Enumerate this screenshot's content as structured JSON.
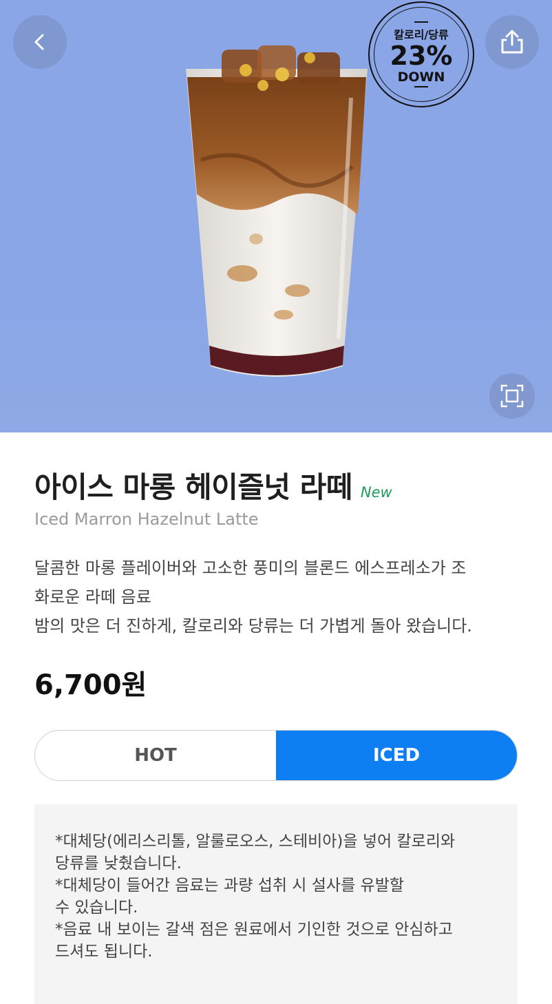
{
  "hero": {
    "badge": {
      "top": "칼로리/당류",
      "percent": "23%",
      "bottom": "DOWN"
    },
    "background_color": "#8aa6e6"
  },
  "product": {
    "name_ko": "아이스 마롱 헤이즐넛 라떼",
    "new_label": "New",
    "name_en": "Iced Marron Hazelnut Latte",
    "description_lines": [
      "달콤한 마롱 플레이버와 고소한 풍미의 블론드 에스프레소가 조",
      "화로운 라떼 음료",
      "밤의 맛은 더 진하게, 칼로리와 당류는 더 가볍게 돌아 왔습니다."
    ],
    "price": "6,700원"
  },
  "temperature": {
    "hot_label": "HOT",
    "iced_label": "ICED",
    "selected": "ICED"
  },
  "notice_lines": [
    "*대체당(에리스리톨, 알룰로오스, 스테비아)을 넣어 칼로리와",
    "당류를 낮췄습니다.",
    "*대체당이 들어간 음료는 과량 섭취 시 설사를 유발할",
    "수 있습니다.",
    "*음료 내 보이는 갈색 점은 원료에서 기인한 것으로 안심하고",
    "드셔도 됩니다."
  ],
  "colors": {
    "accent_blue": "#0d7ff2",
    "new_green": "#1e9a5d"
  },
  "icons": {
    "back": "chevron-left-icon",
    "share": "share-icon",
    "zoom": "fullscreen-icon"
  }
}
